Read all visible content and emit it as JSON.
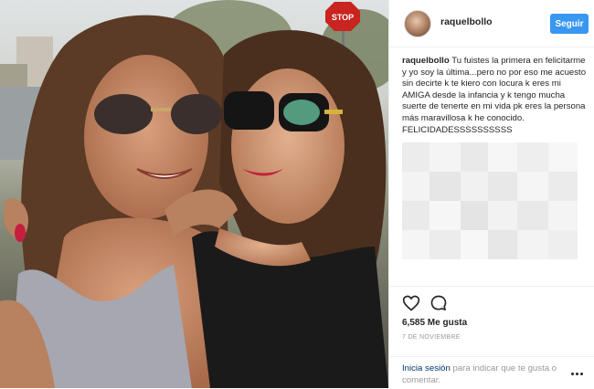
{
  "header": {
    "username": "raquelbollo",
    "follow_label": "Seguir"
  },
  "caption": {
    "username": "raquelbollo",
    "text": " Tu fuistes la primera en felicitarme y yo soy la última...pero no por eso me acuesto sin decirte k te kiero con locura k eres mi AMIGA desde la infancia y k tengo mucha suerte de tenerte en mi vida pk eres la persona más maravillosa k he conocido. FELICIDADESSSSSSSSSS"
  },
  "photo": {
    "sign_text": "STOP"
  },
  "actions": {
    "like_icon": "heart-icon",
    "comment_icon": "comment-icon"
  },
  "likes": "6,585 Me gusta",
  "date": "7 DE NOVIEMBRE",
  "login": {
    "link": "Inicia sesión",
    "rest": " para indicar que te gusta o comentar."
  },
  "colors": {
    "follow_button": "#3897f0",
    "link": "#003569",
    "muted": "#999999"
  }
}
